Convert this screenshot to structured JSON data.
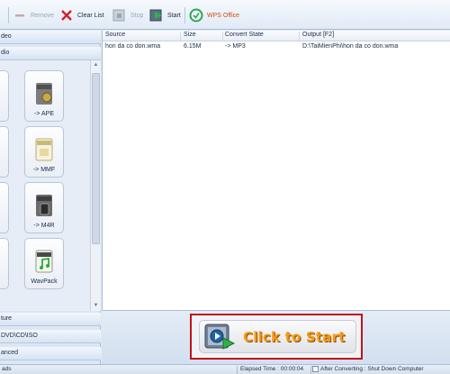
{
  "toolbar": {
    "remove_label": "Remove",
    "clear_label": "Clear List",
    "stop_label": "Stop",
    "start_label": "Start",
    "wps_label": "WPS Office"
  },
  "sidebar": {
    "categories_top": [
      "deo",
      "dio"
    ],
    "categories_bottom": [
      "ture",
      "DVD\\CD\\ISO",
      "anced"
    ]
  },
  "formats": [
    {
      "label": "-> APE",
      "icon": "ape-file-icon"
    },
    {
      "label": "-> MMF",
      "icon": "mmf-file-icon"
    },
    {
      "label": "-> M4R",
      "icon": "m4r-file-icon"
    },
    {
      "label": "WavPack",
      "icon": "wavpack-file-icon"
    }
  ],
  "file_list": {
    "columns": [
      "Source",
      "Size",
      "Convert State",
      "Output [F2]"
    ],
    "rows": [
      {
        "source": "hon da co don.wma",
        "size": "6.15M",
        "state": "-> MP3",
        "output": "D:\\TaiMienPhi\\hon da co don.wma"
      }
    ]
  },
  "start_button": {
    "label": "Click to Start"
  },
  "statusbar": {
    "left": "ads",
    "elapsed": "Elapsed Time : 00:00:04",
    "after": "After Converting : Shut Down Computer"
  },
  "colors": {
    "accent": "#c0121b",
    "start_text": "#f49a1a"
  }
}
